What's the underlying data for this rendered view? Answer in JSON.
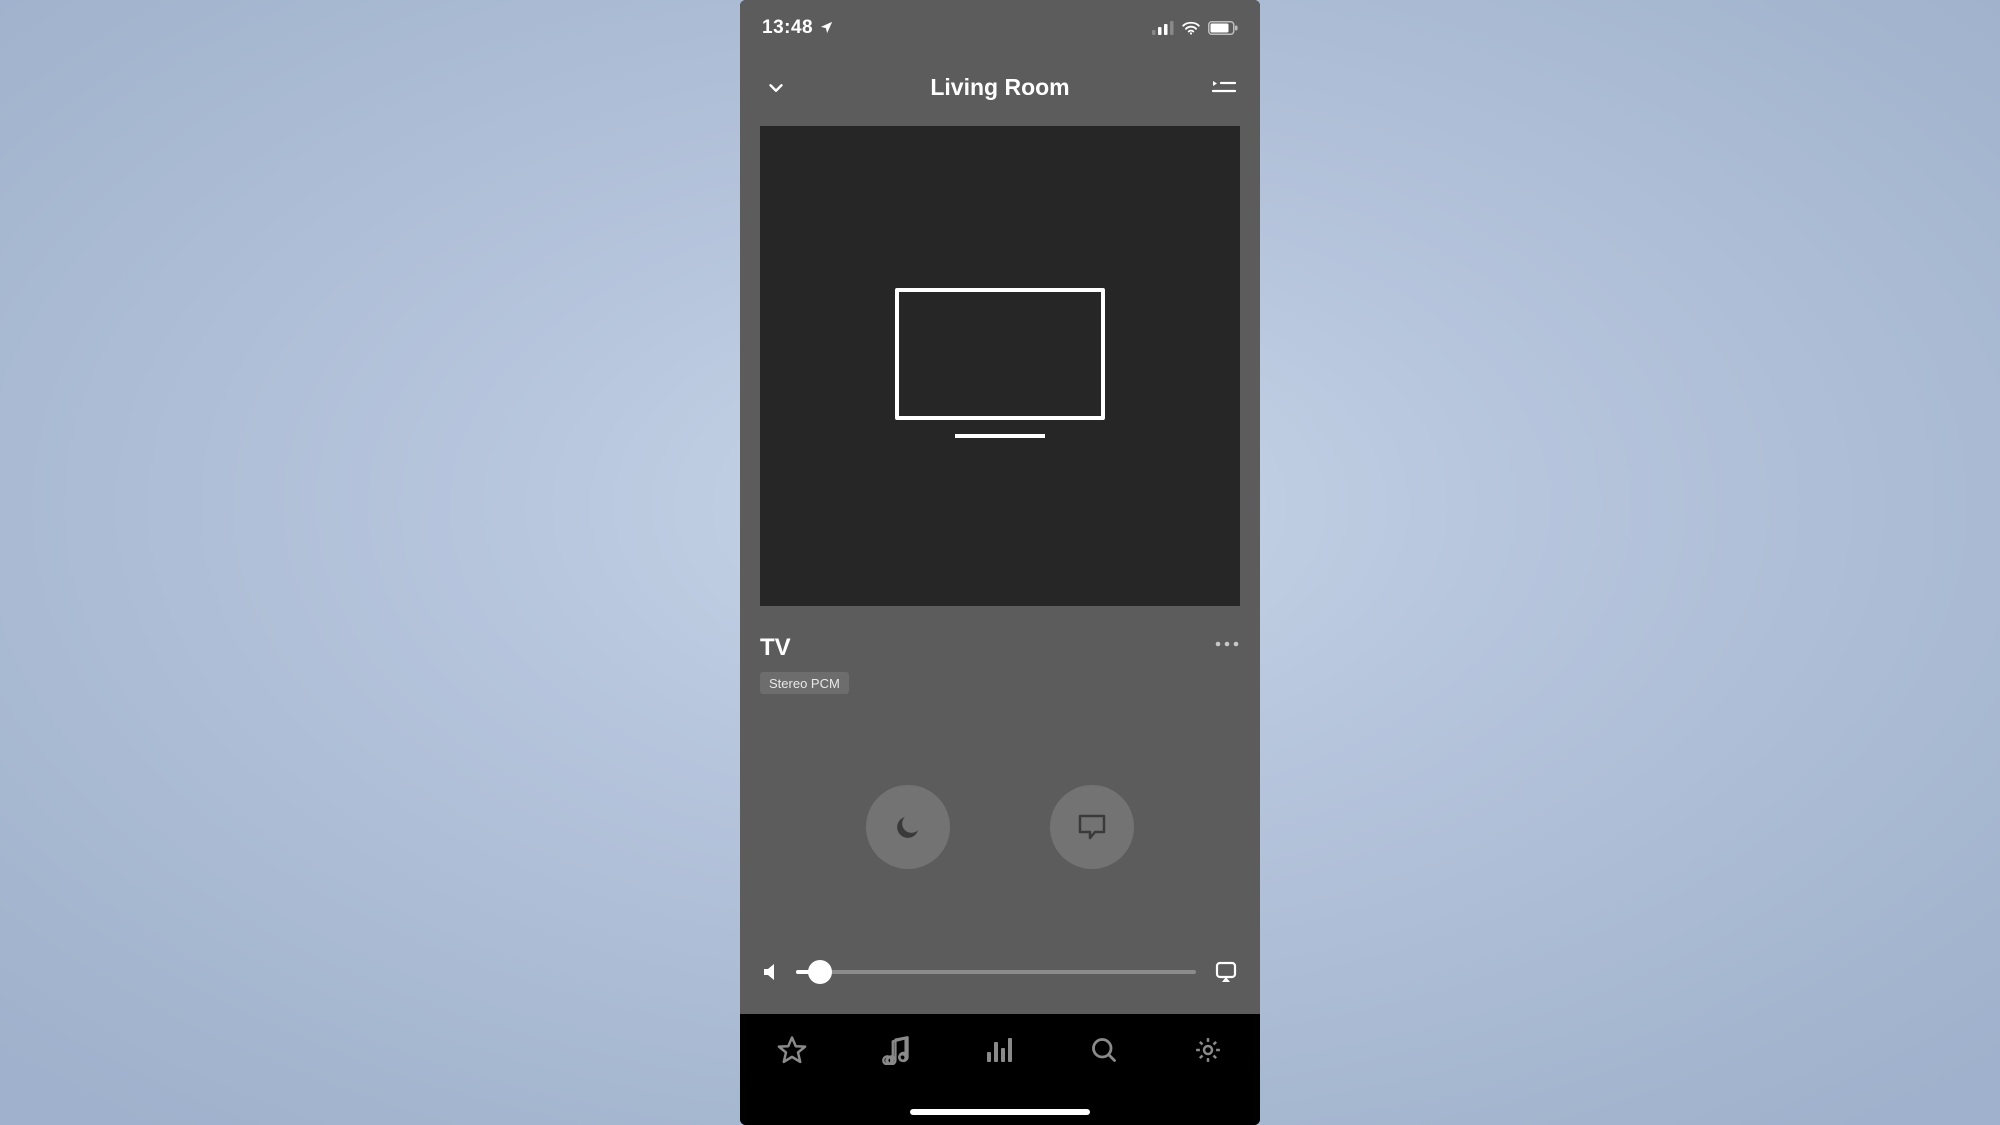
{
  "status": {
    "time": "13:48",
    "location_icon": "location-arrow-icon",
    "signal_bars": 2,
    "wifi_bars": 3,
    "battery_pct": 80
  },
  "header": {
    "collapse_icon": "chevron-down-icon",
    "title": "Living Room",
    "queue_icon": "playlist-icon"
  },
  "now_playing": {
    "artwork_icon": "tv-icon",
    "source_name": "TV",
    "format_badge": "Stereo PCM",
    "more_icon": "more-horizontal-icon"
  },
  "controls": {
    "night_mode_icon": "moon-icon",
    "speech_mode_icon": "speech-bubble-icon"
  },
  "volume": {
    "mute_icon": "volume-low-icon",
    "level_pct": 6,
    "output_icon": "rooms-icon"
  },
  "tabs": {
    "favorites_icon": "star-icon",
    "music_icon": "music-note-icon",
    "rooms_icon": "equalizer-icon",
    "search_icon": "search-icon",
    "settings_icon": "gear-icon"
  }
}
